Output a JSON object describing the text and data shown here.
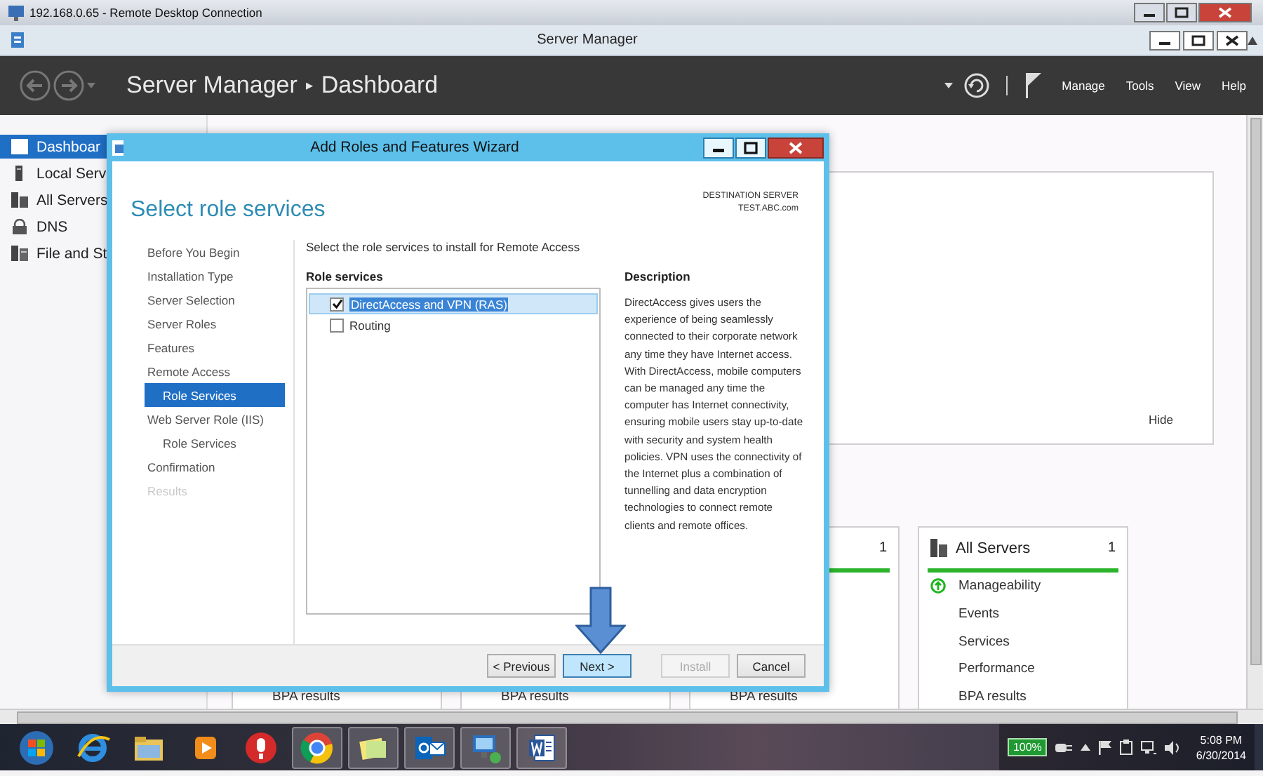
{
  "rdp_window": {
    "title": "192.168.0.65 - Remote Desktop Connection"
  },
  "app_window": {
    "title": "Server Manager"
  },
  "header": {
    "breadcrumb": [
      "Server Manager",
      "Dashboard"
    ],
    "separator": "▸",
    "menu": [
      "Manage",
      "Tools",
      "View",
      "Help"
    ]
  },
  "sidebar": {
    "items": [
      {
        "label": "Dashboar",
        "selected": true
      },
      {
        "label": "Local Serv",
        "selected": false
      },
      {
        "label": "All Servers",
        "selected": false
      },
      {
        "label": "DNS",
        "selected": false
      },
      {
        "label": "File and St",
        "selected": false
      }
    ]
  },
  "welcome_panel": {
    "hide_link": "Hide"
  },
  "tiles": [
    {
      "items": [
        {
          "label": "BPA results"
        }
      ]
    },
    {
      "items": [
        {
          "label": "BPA results"
        }
      ]
    },
    {
      "count": "1",
      "items": [
        {
          "label": "BPA results"
        }
      ]
    },
    {
      "title": "All Servers",
      "count": "1",
      "items": [
        {
          "label": "Manageability",
          "healthy": true
        },
        {
          "label": "Events"
        },
        {
          "label": "Services"
        },
        {
          "label": "Performance"
        },
        {
          "label": "BPA results"
        }
      ]
    }
  ],
  "dialog": {
    "title": "Add Roles and Features Wizard",
    "heading": "Select role services",
    "destination_label": "DESTINATION SERVER",
    "destination_server": "TEST.ABC.com",
    "steps": [
      {
        "label": "Before You Begin",
        "selected": false,
        "disabled": false
      },
      {
        "label": "Installation Type",
        "selected": false,
        "disabled": false
      },
      {
        "label": "Server Selection",
        "selected": false,
        "disabled": false
      },
      {
        "label": "Server Roles",
        "selected": false,
        "disabled": false
      },
      {
        "label": "Features",
        "selected": false,
        "disabled": false
      },
      {
        "label": "Remote Access",
        "selected": false,
        "disabled": false,
        "children": [
          {
            "label": "Role Services",
            "selected": true,
            "disabled": false
          }
        ]
      },
      {
        "label": "Web Server Role (IIS)",
        "selected": false,
        "disabled": false,
        "children": [
          {
            "label": "Role Services",
            "selected": false,
            "disabled": false
          }
        ]
      },
      {
        "label": "Confirmation",
        "selected": false,
        "disabled": false
      },
      {
        "label": "Results",
        "selected": false,
        "disabled": true
      }
    ],
    "instruction": "Select the role services to install for Remote Access",
    "role_services": {
      "header": "Role services",
      "items": [
        {
          "label": "DirectAccess and VPN (RAS)",
          "checked": true,
          "selected": true
        },
        {
          "label": "Routing",
          "checked": false,
          "selected": false
        }
      ]
    },
    "description": {
      "header": "Description",
      "text": "DirectAccess gives users the experience of being seamlessly connected to their corporate network any time they have Internet access. With DirectAccess, mobile computers can be managed any time the computer has Internet connectivity, ensuring mobile users stay up-to-date with security and system health policies. VPN uses the connectivity of the Internet plus a combination of tunnelling and data encryption technologies to connect remote clients and remote offices."
    },
    "buttons": [
      {
        "label": "< Previous",
        "disabled": false,
        "highlighted": false
      },
      {
        "label": "Next >",
        "disabled": false,
        "highlighted": true
      },
      {
        "label": "Install",
        "disabled": true,
        "highlighted": false
      },
      {
        "label": "Cancel",
        "disabled": false,
        "highlighted": false
      }
    ]
  },
  "taskbar": {
    "battery": "100%",
    "time": "5:08 PM",
    "date": "6/30/2014"
  }
}
